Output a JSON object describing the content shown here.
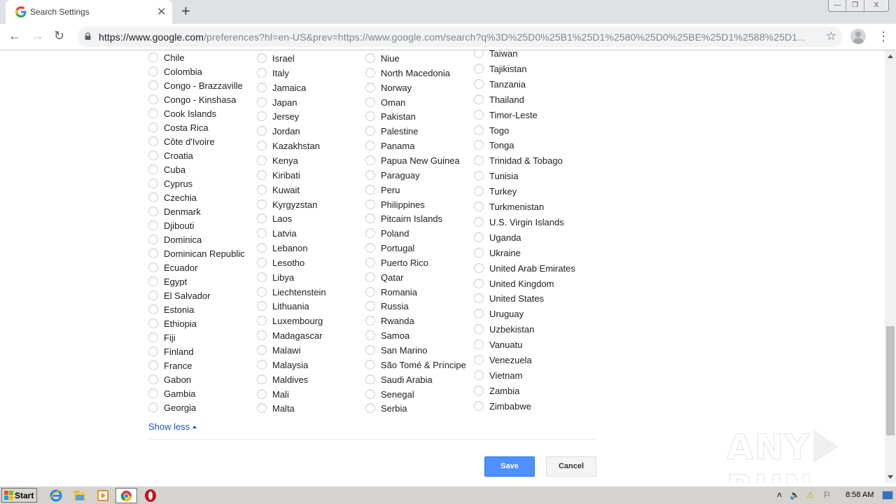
{
  "browser": {
    "tab_title": "Search Settings",
    "url_host": "https://www.google.com",
    "url_rest": "/preferences?hl=en-US&prev=https://www.google.com/search?q%3D%25D0%25B1%25D1%2580%25D0%25BE%25D1%2588%25D1...",
    "window_buttons": [
      "—",
      "❐",
      "X"
    ]
  },
  "regions": {
    "columns": [
      [
        "Chile",
        "Colombia",
        "Congo - Brazzaville",
        "Congo - Kinshasa",
        "Cook Islands",
        "Costa Rica",
        "Côte d'Ivoire",
        "Croatia",
        "Cuba",
        "Cyprus",
        "Czechia",
        "Denmark",
        "Djibouti",
        "Dominica",
        "Dominican Republic",
        "Ecuador",
        "Egypt",
        "El Salvador",
        "Estonia",
        "Ethiopia",
        "Fiji",
        "Finland",
        "France",
        "Gabon",
        "Gambia",
        "Georgia"
      ],
      [
        "Israel",
        "Italy",
        "Jamaica",
        "Japan",
        "Jersey",
        "Jordan",
        "Kazakhstan",
        "Kenya",
        "Kiribati",
        "Kuwait",
        "Kyrgyzstan",
        "Laos",
        "Latvia",
        "Lebanon",
        "Lesotho",
        "Libya",
        "Liechtenstein",
        "Lithuania",
        "Luxembourg",
        "Madagascar",
        "Malawi",
        "Malaysia",
        "Maldives",
        "Mali",
        "Malta"
      ],
      [
        "Niue",
        "North Macedonia",
        "Norway",
        "Oman",
        "Pakistan",
        "Palestine",
        "Panama",
        "Papua New Guinea",
        "Paraguay",
        "Peru",
        "Philippines",
        "Pitcairn Islands",
        "Poland",
        "Portugal",
        "Puerto Rico",
        "Qatar",
        "Romania",
        "Russia",
        "Rwanda",
        "Samoa",
        "San Marino",
        "São Tomé & Príncipe",
        "Saudi Arabia",
        "Senegal",
        "Serbia"
      ],
      [
        "Taiwan",
        "Tajikistan",
        "Tanzania",
        "Thailand",
        "Timor-Leste",
        "Togo",
        "Tonga",
        "Trinidad & Tobago",
        "Tunisia",
        "Turkey",
        "Turkmenistan",
        "U.S. Virgin Islands",
        "Uganda",
        "Ukraine",
        "United Arab Emirates",
        "United Kingdom",
        "United States",
        "Uruguay",
        "Uzbekistan",
        "Vanuatu",
        "Venezuela",
        "Vietnam",
        "Zambia",
        "Zimbabwe"
      ]
    ],
    "show_less": "Show less"
  },
  "actions": {
    "save": "Save",
    "cancel": "Cancel"
  },
  "watermark": {
    "left": "ANY",
    "right": "RUN"
  },
  "taskbar": {
    "start": "Start",
    "clock": "8:58 AM"
  }
}
